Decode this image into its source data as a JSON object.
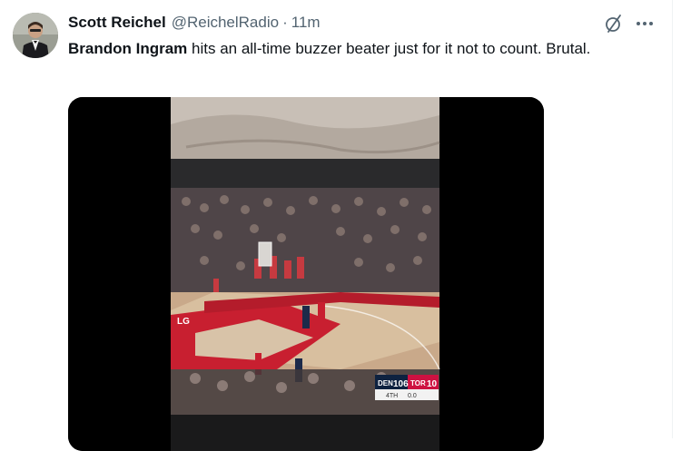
{
  "tweet": {
    "author": {
      "display_name": "Scott Reichel",
      "handle": "@ReichelRadio",
      "separator": "·",
      "time": "11m",
      "avatar_icon": "avatar-photo-man-in-suit"
    },
    "text": {
      "mention": "Brandon Ingram",
      "body": " hits an all-time buzzer beater just for it not to count. Brutal."
    },
    "actions": {
      "grok_icon": "grok-slash-icon",
      "more_icon": "more-horizontal-icon"
    },
    "media": {
      "type": "video",
      "scoreboard": {
        "team1": "DEN",
        "score1": "106",
        "team2": "TOR",
        "score2": "10",
        "quarter": "4TH",
        "clock": "0.0"
      },
      "court_text": "LG",
      "colors": {
        "den_navy": "#0e2240",
        "tor_red": "#ce1141"
      }
    }
  }
}
